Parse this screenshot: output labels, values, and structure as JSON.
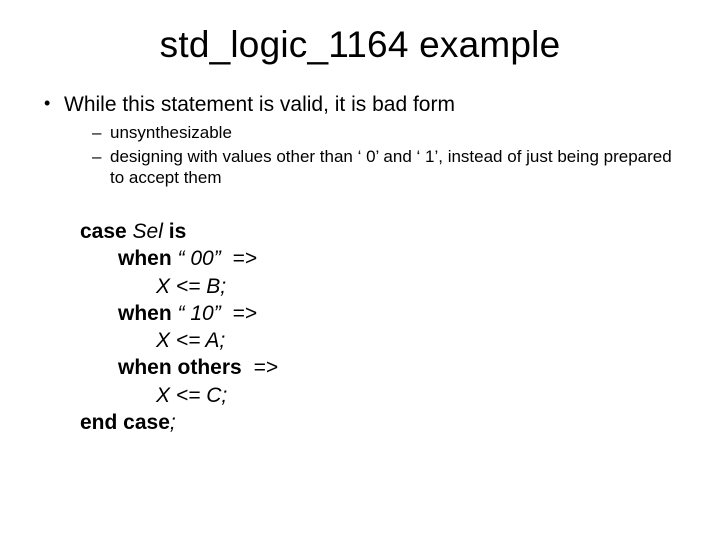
{
  "title": "std_logic_1164 example",
  "bullets": {
    "main": "While this statement is valid, it is bad form",
    "sub": [
      "unsynthesizable",
      "designing with values other than ‘ 0’ and ‘ 1’, instead of just being prepared to accept them"
    ]
  },
  "code": {
    "l1_a": "case",
    "l1_b": " Sel ",
    "l1_c": "is",
    "l2_a": "when",
    "l2_b": " “ 00”  =>",
    "l3": "X <= B;",
    "l4_a": "when",
    "l4_b": " “ 10”  =>",
    "l5": "X <= A;",
    "l6": "when others  ",
    "l6_b": "=>",
    "l7": "X <= C;",
    "l8": "end case",
    "l8_b": ";"
  }
}
